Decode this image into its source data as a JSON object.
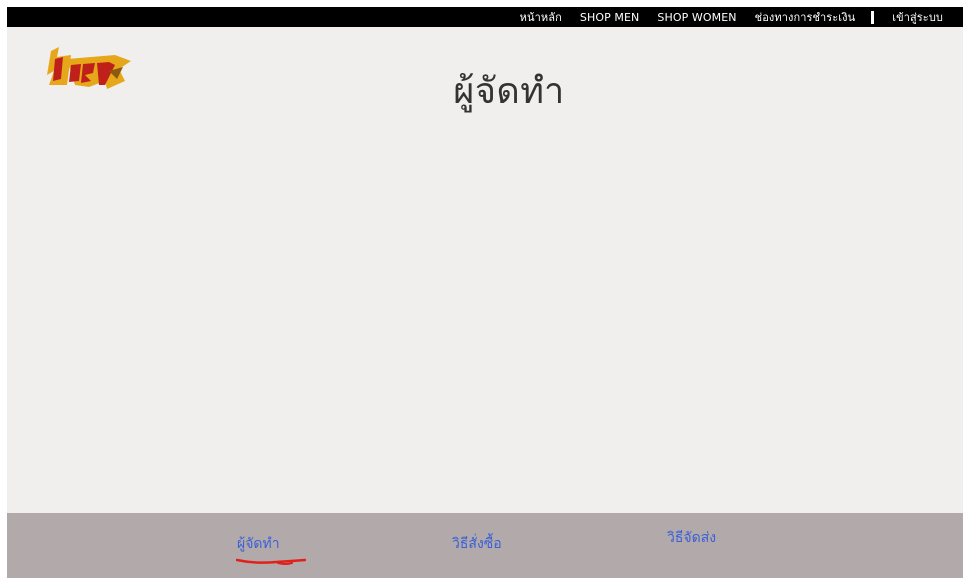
{
  "topnav": {
    "items": [
      {
        "label": "หน้าหลัก"
      },
      {
        "label": "SHOP MEN"
      },
      {
        "label": "SHOP WOMEN"
      },
      {
        "label": "ช่องทางการชำระเงิน"
      }
    ],
    "login_label": "เข้าสู่ระบบ"
  },
  "logo": {
    "icon": "brand-logo-icon",
    "text": "HSV"
  },
  "page": {
    "title": "ผู้จัดทำ"
  },
  "footer": {
    "links": [
      {
        "label": "ผู้จัดทำ",
        "active": true
      },
      {
        "label": "วิธีสั่งซื้อ",
        "active": false
      },
      {
        "label": "วิธีจัดส่ง",
        "active": false
      }
    ]
  },
  "colors": {
    "topbar_bg": "#000000",
    "content_bg": "#f0efee",
    "footer_bg": "#b2aaaa",
    "footer_link": "#3a5fd6",
    "active_underline": "#e0201b",
    "logo_gold": "#e6a81a",
    "logo_red": "#c0201a"
  }
}
